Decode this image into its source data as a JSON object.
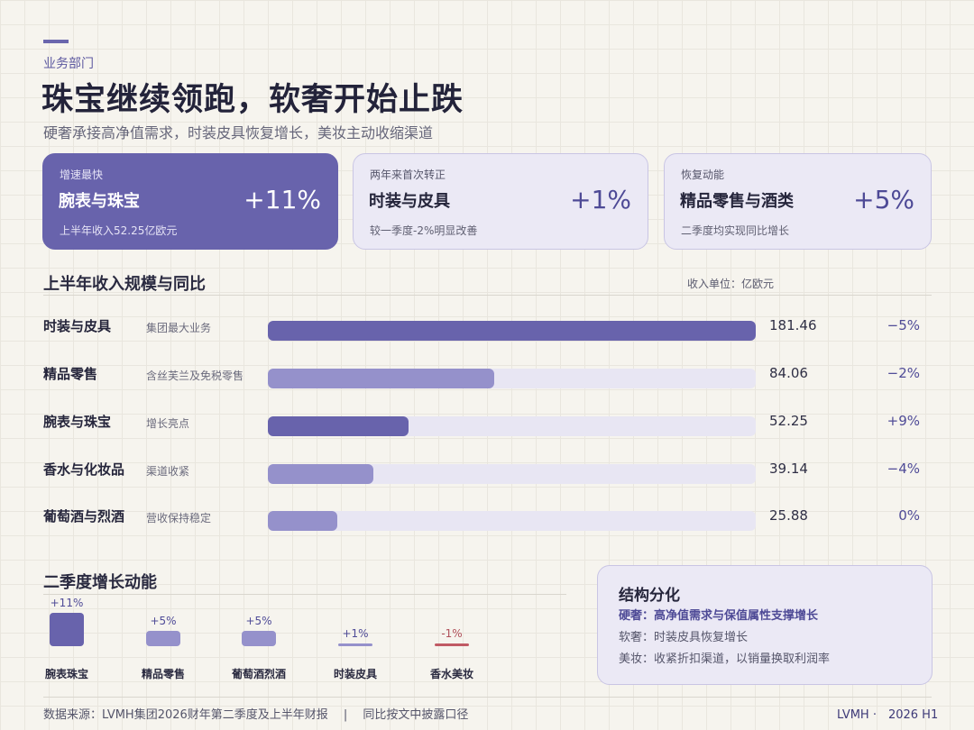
{
  "header": {
    "section_tag": "业务部门",
    "title": "珠宝继续领跑，软奢开始止跌",
    "subtitle": "硬奢承接高净值需求，时装皮具恢复增长，美妆主动收缩渠道"
  },
  "kpis": [
    {
      "tag": "增速最快",
      "name": "腕表与珠宝",
      "value": "+11%",
      "note": "上半年收入52.25亿欧元"
    },
    {
      "tag": "两年来首次转正",
      "name": "时装与皮具",
      "value": "+1%",
      "note": "较一季度-2%明显改善"
    },
    {
      "tag": "恢复动能",
      "name": "精品零售与酒类",
      "value": "+5%",
      "note": "二季度均实现同比增长"
    }
  ],
  "revenue": {
    "title": "上半年收入规模与同比",
    "unit_note": "收入单位：亿欧元"
  },
  "colors": {
    "primary": "#6863ac",
    "secondary": "#9591cb",
    "track": "#e8e6f3",
    "negative": "#c05a64"
  },
  "chart_data": [
    {
      "type": "bar",
      "orientation": "horizontal",
      "title": "上半年收入规模与同比",
      "unit": "亿欧元",
      "categories": [
        "时装与皮具",
        "精品零售",
        "腕表与珠宝",
        "香水与化妆品",
        "葡萄酒与烈酒"
      ],
      "descriptions": [
        "集团最大业务",
        "含丝芙兰及免税零售",
        "增长亮点",
        "渠道收紧",
        "营收保持稳定"
      ],
      "values": [
        181.46,
        84.06,
        52.25,
        39.14,
        25.88
      ],
      "value_labels": [
        "181.46",
        "84.06",
        "52.25",
        "39.14",
        "25.88"
      ],
      "yoy_change": [
        "−5%",
        "−2%",
        "+9%",
        "−4%",
        "0%"
      ],
      "highlighted": [
        true,
        false,
        true,
        false,
        false
      ],
      "xlim": [
        0,
        181.46
      ]
    },
    {
      "type": "bar",
      "title": "二季度增长动能",
      "categories": [
        "腕表珠宝",
        "精品零售",
        "葡萄酒烈酒",
        "时装皮具",
        "香水美妆"
      ],
      "values": [
        11,
        5,
        5,
        1,
        -1
      ],
      "value_labels": [
        "+11%",
        "+5%",
        "+5%",
        "+1%",
        "-1%"
      ]
    }
  ],
  "structure": {
    "title": "结构分化",
    "lines": [
      "硬奢：高净值需求与保值属性支撑增长",
      "软奢：时装皮具恢复增长",
      "美妆：收紧折扣渠道，以销量换取利润率"
    ]
  },
  "footer": {
    "source": "数据来源：LVMH集团2026财年第二季度及上半年财报　 |　 同比按文中披露口径",
    "brand": "LVMH ·　2026 H1"
  }
}
